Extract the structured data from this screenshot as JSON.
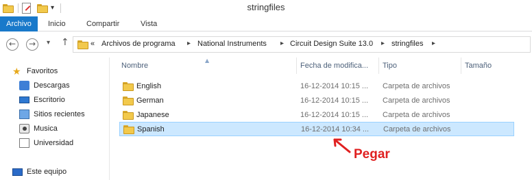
{
  "window": {
    "title": "stringfiles"
  },
  "ribbon": {
    "tabs": [
      "Archivo",
      "Inicio",
      "Compartir",
      "Vista"
    ]
  },
  "address": {
    "overflow": "«",
    "crumbs": [
      "Archivos de programa",
      "National Instruments",
      "Circuit Design Suite 13.0",
      "stringfiles"
    ]
  },
  "nav": {
    "favorites": "Favoritos",
    "items": [
      "Descargas",
      "Escritorio",
      "Sitios recientes",
      "Musica",
      "Universidad"
    ],
    "this_pc": "Este equipo"
  },
  "columns": [
    "Nombre",
    "Fecha de modifica...",
    "Tipo",
    "Tamaño"
  ],
  "files": [
    {
      "name": "English",
      "date": "16-12-2014 10:15 ...",
      "type": "Carpeta de archivos"
    },
    {
      "name": "German",
      "date": "16-12-2014 10:15 ...",
      "type": "Carpeta de archivos"
    },
    {
      "name": "Japanese",
      "date": "16-12-2014 10:15 ...",
      "type": "Carpeta de archivos"
    },
    {
      "name": "Spanish",
      "date": "16-12-2014 10:34 ...",
      "type": "Carpeta de archivos",
      "selected": true
    }
  ],
  "annotation": {
    "text": "Pegar",
    "color": "#e02020"
  },
  "colors": {
    "accent": "#1979ca",
    "selection": "#cce8ff",
    "folder": "#f2c94c"
  }
}
